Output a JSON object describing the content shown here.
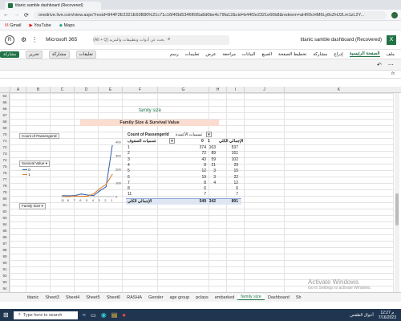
{
  "browser": {
    "tab_title": "titanic samble dashboard (Recovered)",
    "url": "onedrive.live.com/view.aspx?resid=844F2E2321E60B80%21c71c16f4f3d5346f695a8d0be4c79fa12&cid=b44f2e2321e60b8&redeem=aHR0cHM6Ly8xZHJ2Lm1zL2Y...",
    "bookmarks": [
      "Gmail",
      "YouTube",
      "Maps"
    ]
  },
  "app": {
    "name": "Microsoft 365",
    "doc_title": "titanic samble dashboard (Recovered)",
    "search_placeholder": "بحث عن أدوات وتطبيقات والمزيد (Alt + Q)",
    "account_initial": "R",
    "accent": "#217346"
  },
  "ribbon": {
    "tabs": [
      "ملف",
      "الصفحة الرئيسية",
      "إدراج",
      "مشاركة",
      "تخطيط الصفحة",
      "الصيغ",
      "البيانات",
      "مراجعة",
      "عرض",
      "تعليمات",
      "رسم"
    ],
    "active_tab": "الصفحة الرئيسية",
    "editing_label": "تحرير",
    "share_label": "مشاركة",
    "comments_label": "تعليقات"
  },
  "grid": {
    "columns": [
      "A",
      "B",
      "C",
      "D",
      "E",
      "F",
      "G",
      "H",
      "I",
      "J",
      "K"
    ],
    "rows": [
      "64",
      "65",
      "66",
      "67",
      "68",
      "69",
      "70",
      "71",
      "72",
      "73",
      "74",
      "75",
      "76",
      "77",
      "78",
      "79",
      "80",
      "81",
      "82",
      "83",
      "84",
      "85",
      "86",
      "87",
      "88",
      "89",
      "90",
      "91",
      "92",
      "93",
      "94"
    ],
    "title_text": "family size",
    "banner_text": "Family Size  & Survival Value"
  },
  "pivot": {
    "corner": "Count of PassengerId",
    "col_field": "تسميات الأعمدة",
    "row_field": "تسميات الصفوف",
    "col_headers": [
      "0",
      "1",
      "الإجمالي الكلي"
    ],
    "rows": [
      {
        "label": "1",
        "c0": "374",
        "c1": "163",
        "total": "537"
      },
      {
        "label": "2",
        "c0": "72",
        "c1": "89",
        "total": "161"
      },
      {
        "label": "3",
        "c0": "43",
        "c1": "59",
        "total": "102"
      },
      {
        "label": "4",
        "c0": "8",
        "c1": "21",
        "total": "29"
      },
      {
        "label": "5",
        "c0": "12",
        "c1": "3",
        "total": "15"
      },
      {
        "label": "6",
        "c0": "19",
        "c1": "3",
        "total": "22"
      },
      {
        "label": "7",
        "c0": "8",
        "c1": "4",
        "total": "12"
      },
      {
        "label": "8",
        "c0": "6",
        "c1": "",
        "total": "6"
      },
      {
        "label": "11",
        "c0": "7",
        "c1": "",
        "total": "7"
      }
    ],
    "grand_label": "الإجمالي الكلي",
    "grand": {
      "c0": "549",
      "c1": "342",
      "total": "891"
    }
  },
  "chart_data": {
    "type": "line",
    "title": "Count of PassengerId",
    "categories": [
      "11",
      "8",
      "7",
      "6",
      "5",
      "4",
      "3",
      "2",
      "1"
    ],
    "series": [
      {
        "name": "0",
        "values": [
          7,
          6,
          8,
          19,
          12,
          8,
          43,
          72,
          374
        ],
        "color": "#2e5fa8"
      },
      {
        "name": "1",
        "values": [
          0,
          0,
          4,
          3,
          3,
          21,
          59,
          89,
          163
        ],
        "color": "#e07b2a"
      }
    ],
    "ylim": [
      0,
      400
    ],
    "yticks": [
      "400",
      "300",
      "200",
      "100",
      "0"
    ],
    "filter_label": "Survival Value",
    "axis_field_label": "Family Size"
  },
  "sheet_tabs": [
    "titanic",
    "Sheet3",
    "Sheet4",
    "Sheet5",
    "Sheet6",
    "RASHA",
    "Gender",
    "age group",
    "pclass",
    "embarked",
    "family size",
    "Dashboard",
    "Sh"
  ],
  "active_sheet": "family size",
  "watermark": {
    "line1": "Activate Windows",
    "line2": "Go to Settings to activate Windows."
  },
  "taskbar": {
    "search_placeholder": "Type here to search",
    "time": "12:27 م",
    "date": "7/16/2023",
    "weather": "أحوال الطقس"
  }
}
